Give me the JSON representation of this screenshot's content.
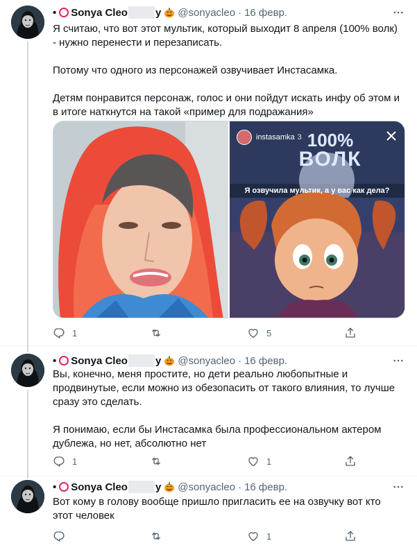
{
  "colors": {
    "accent": "#1d9bf0",
    "text": "#0f1419",
    "muted": "#536471",
    "ring": "#e0245e"
  },
  "tweets": [
    {
      "name_prefix": "•",
      "name_part1": "Sonya Cleo",
      "name_part2": "y",
      "handle": "@sonyacleo",
      "separator": "·",
      "date": "16 февр.",
      "paragraphs": [
        "Я считаю, что вот этот мультик, который выходит 8 апреля (100% волк) - нужно перенести и перезаписать.",
        "Потому что одного из персонажей озвучивает Инстасамка.",
        "Детям понравится персонаж, голос и они пойдут искать инфу об этом и в итоге наткнутся на такой «пример для подражания»"
      ],
      "media": {
        "story_user": "instasamka",
        "story_time": "3",
        "logo_line1": "100%",
        "logo_line2": "ВОЛК",
        "caption": "Я озвучила мультик, а у вас как дела?"
      },
      "actions": {
        "replies": "1",
        "retweets": "",
        "likes": "5",
        "share": ""
      }
    },
    {
      "name_prefix": "•",
      "name_part1": "Sonya Cleo",
      "name_part2": "y",
      "handle": "@sonyacleo",
      "separator": "·",
      "date": "16 февр.",
      "paragraphs": [
        "Вы, конечно, меня простите, но дети реально любопытные и продвинутые, если можно из обезопасить от такого влияния, то лучше сразу это сделать.",
        "Я понимаю, если бы Инстасамка была профессиональном актером дублежа, но нет, абсолютно нет"
      ],
      "actions": {
        "replies": "1",
        "retweets": "",
        "likes": "1",
        "share": ""
      }
    },
    {
      "name_prefix": "•",
      "name_part1": "Sonya Cleo",
      "name_part2": "y",
      "handle": "@sonyacleo",
      "separator": "·",
      "date": "16 февр.",
      "paragraphs": [
        "Вот кому в голову вообще пришло пригласить ее на озвучку вот кто этот человек"
      ],
      "actions": {
        "replies": "",
        "retweets": "",
        "likes": "1",
        "share": ""
      }
    }
  ]
}
